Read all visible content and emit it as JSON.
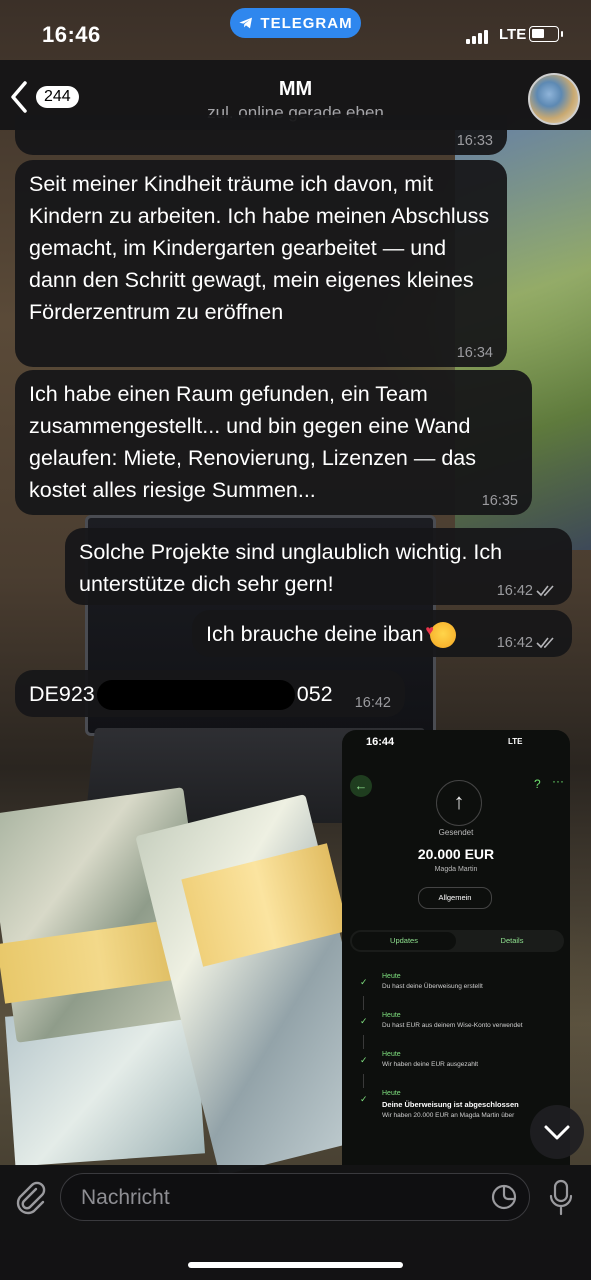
{
  "status_bar": {
    "time": "16:46",
    "app_pill": "TELEGRAM",
    "network": "LTE"
  },
  "header": {
    "back_count": "244",
    "title": "MM",
    "subtitle": "zul. online gerade eben"
  },
  "messages": [
    {
      "direction": "in",
      "text": "",
      "time": "16:33"
    },
    {
      "direction": "in",
      "text": "Seit meiner Kindheit träume ich davon, mit Kindern zu arbeiten. Ich habe meinen Abschluss gemacht, im Kindergarten gearbeitet — und dann den Schritt gewagt, mein eigenes kleines Förderzentrum zu eröffnen",
      "time": "16:34"
    },
    {
      "direction": "in",
      "text": "Ich habe einen Raum gefunden, ein Team zusammengestellt... und bin gegen eine Wand gelaufen: Miete, Renovierung, Lizenzen — das kostet alles riesige Summen...",
      "time": "16:35"
    },
    {
      "direction": "out",
      "text": "Solche Projekte sind unglaublich wichtig. Ich unterstütze dich sehr gern!",
      "time": "16:42"
    },
    {
      "direction": "out",
      "text": "Ich brauche deine iban",
      "time": "16:42"
    },
    {
      "direction": "in",
      "text_start": "DE923",
      "text_end": "052",
      "time": "16:42"
    }
  ],
  "wise_screenshot": {
    "time": "16:44",
    "network": "LTE",
    "sent_label": "Gesendet",
    "amount": "20.000 EUR",
    "recipient": "Magda Martin",
    "general_button": "Allgemein",
    "tab_updates": "Updates",
    "tab_details": "Details",
    "steps": [
      {
        "heading": "Heute",
        "detail": "Du hast deine Überweisung erstellt"
      },
      {
        "heading": "Heute",
        "detail": "Du hast EUR aus deinem Wise-Konto verwendet"
      },
      {
        "heading": "Heute",
        "detail": "Wir haben deine EUR ausgezahlt"
      },
      {
        "heading": "Heute",
        "detail": "Deine Überweisung ist abgeschlossen",
        "sub": "Wir haben 20.000 EUR an Magda Martin über"
      }
    ]
  },
  "input": {
    "placeholder": "Nachricht"
  },
  "colors": {
    "telegram_blue": "#2f87ee",
    "bubble": "#161618",
    "wise_green": "#7fe07f"
  }
}
